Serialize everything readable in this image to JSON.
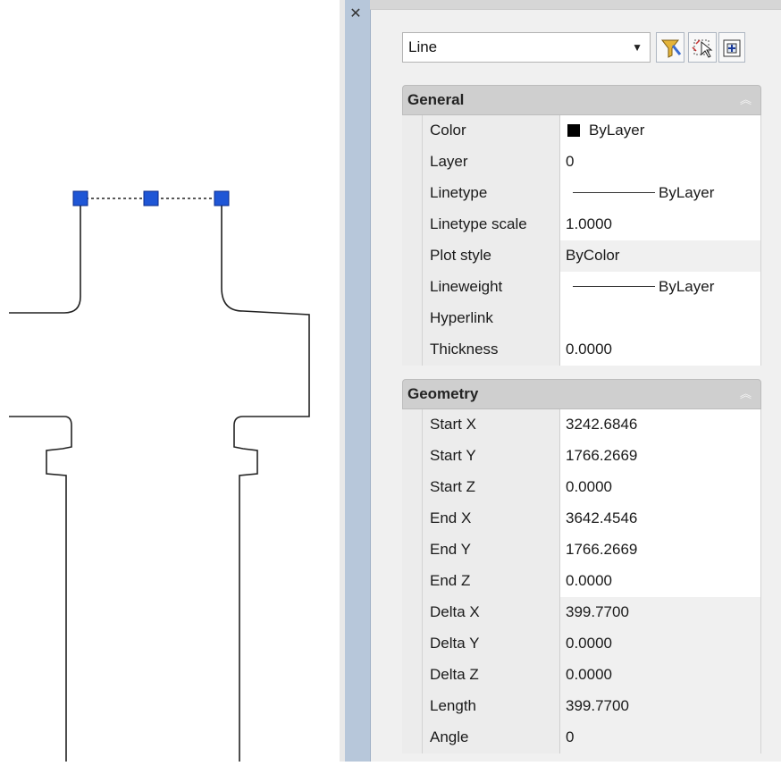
{
  "palette": {
    "close_icon": "close-icon",
    "object_type": "Line",
    "toolbar_icons": [
      "quick-select-icon",
      "select-objects-icon",
      "toggle-pickadd-icon"
    ]
  },
  "general": {
    "title": "General",
    "rows": [
      {
        "name": "Color",
        "value": "ByLayer",
        "swatch": "#000000"
      },
      {
        "name": "Layer",
        "value": "0"
      },
      {
        "name": "Linetype",
        "value": "ByLayer"
      },
      {
        "name": "Linetype scale",
        "value": "1.0000"
      },
      {
        "name": "Plot style",
        "value": "ByColor"
      },
      {
        "name": "Lineweight",
        "value": "ByLayer"
      },
      {
        "name": "Hyperlink",
        "value": ""
      },
      {
        "name": "Thickness",
        "value": "0.0000"
      }
    ]
  },
  "geometry": {
    "title": "Geometry",
    "rows": [
      {
        "name": "Start X",
        "value": "3242.6846"
      },
      {
        "name": "Start Y",
        "value": "1766.2669"
      },
      {
        "name": "Start Z",
        "value": "0.0000"
      },
      {
        "name": "End X",
        "value": "3642.4546"
      },
      {
        "name": "End Y",
        "value": "1766.2669"
      },
      {
        "name": "End Z",
        "value": "0.0000"
      },
      {
        "name": "Delta X",
        "value": "399.7700"
      },
      {
        "name": "Delta Y",
        "value": "0.0000"
      },
      {
        "name": "Delta Z",
        "value": "0.0000"
      },
      {
        "name": "Length",
        "value": "399.7700"
      },
      {
        "name": "Angle",
        "value": "0"
      }
    ]
  },
  "colors": {
    "grip": "#1f56d6",
    "header_bg": "#cfcfcf",
    "panel_bar": "#b7c7da"
  }
}
